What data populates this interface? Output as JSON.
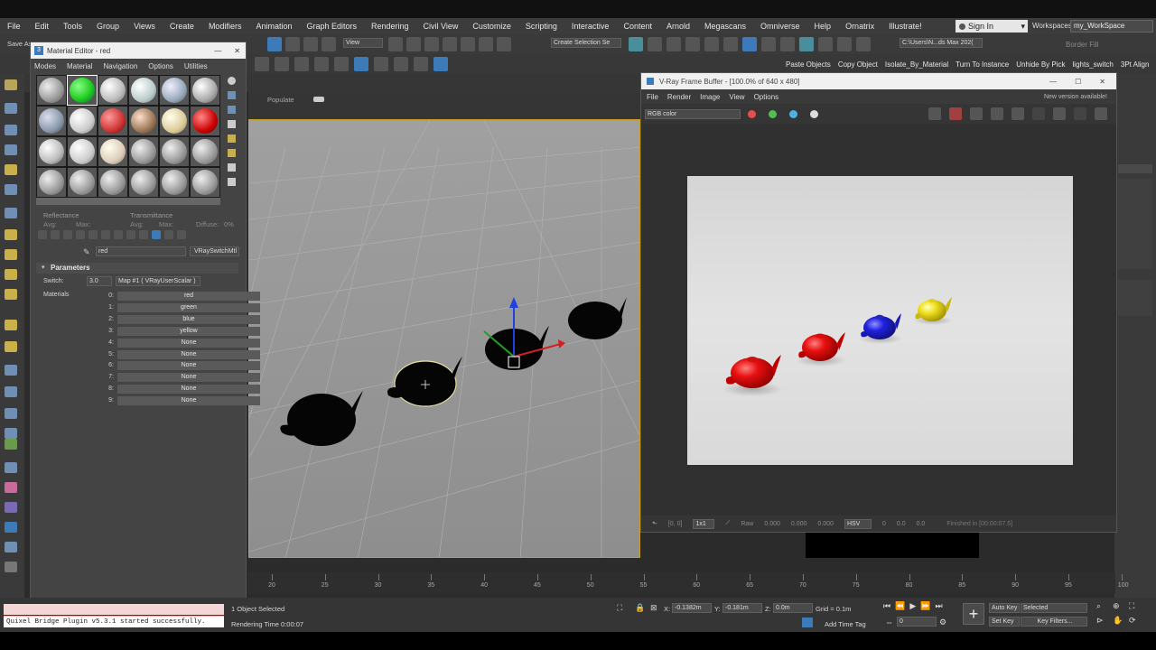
{
  "menu": [
    "File",
    "Edit",
    "Tools",
    "Group",
    "Views",
    "Create",
    "Modifiers",
    "Animation",
    "Graph Editors",
    "Rendering",
    "Civil View",
    "Customize",
    "Scripting",
    "Interactive",
    "Content",
    "Arnold",
    "Megascans",
    "Omniverse",
    "Help",
    "Ornatrix",
    "Illustrate!"
  ],
  "signin_label": "Sign In",
  "workspaces_label": "Workspaces:",
  "workspace_value": "my_WorkSpace",
  "toolbar": {
    "view_dropdown": "View",
    "selection_set": "Create Selection Se",
    "path": "C:\\Users\\N...ds Max 202(",
    "border_fill": "Border Fill",
    "save_as": "Save As"
  },
  "shelf": [
    "Paste Objects",
    "Copy Object",
    "Isolate_By_Material",
    "Turn To Instance",
    "Unhide By Pick",
    "lights_switch",
    "3Pt Align"
  ],
  "viewport_populate": "Populate",
  "material_editor": {
    "title": "Material Editor - red",
    "menu": [
      "Modes",
      "Material",
      "Navigation",
      "Options",
      "Utilities"
    ],
    "reflectance": "Reflectance",
    "avg": "Avg:",
    "max": "Max:",
    "transmittance": "Transmittance",
    "diffuse": "Diffuse:",
    "diffuse_value": "0%",
    "mat_name": "red",
    "mat_type": "VRaySwitchMtl",
    "parameters": "Parameters",
    "switch_label": "Switch:",
    "switch_value": "3.0",
    "map_label": "Map #1  ( VRayUserScalar )",
    "materials_label": "Materials",
    "materials": [
      {
        "idx": "0:",
        "name": "red"
      },
      {
        "idx": "1:",
        "name": "green"
      },
      {
        "idx": "2:",
        "name": "blue"
      },
      {
        "idx": "3:",
        "name": "yellow"
      },
      {
        "idx": "4:",
        "name": "None"
      },
      {
        "idx": "5:",
        "name": "None"
      },
      {
        "idx": "6:",
        "name": "None"
      },
      {
        "idx": "7:",
        "name": "None"
      },
      {
        "idx": "8:",
        "name": "None"
      },
      {
        "idx": "9:",
        "name": "None"
      }
    ]
  },
  "vfb": {
    "title": "V-Ray Frame Buffer - [100.0% of 640 x 480]",
    "menu": [
      "File",
      "Render",
      "Image",
      "View",
      "Options"
    ],
    "new_version": "New version available!",
    "channel": "RGB color",
    "coords": "[0, 0]",
    "zoom": "1x1",
    "raw": "Raw",
    "raw_values": [
      "0.000",
      "0.000",
      "0.000"
    ],
    "color_mode": "HSV",
    "hsv_values": [
      "0",
      "0.0",
      "0.0"
    ],
    "finished": "Finished in [00:00:07.5]"
  },
  "timeline_ticks": [
    "20",
    "25",
    "30",
    "35",
    "40",
    "45",
    "50",
    "55",
    "60",
    "65",
    "70",
    "75",
    "80",
    "85",
    "90",
    "95",
    "100"
  ],
  "status": {
    "selected": "1 Object Selected",
    "render_time": "Rendering Time  0:00:07",
    "x_label": "X:",
    "x_value": "-0.1382m",
    "y_label": "Y:",
    "y_value": "-0.181m",
    "z_label": "Z:",
    "z_value": "0.0m",
    "grid": "Grid = 0.1m",
    "add_time_tag": "Add Time Tag",
    "auto_key": "Auto Key",
    "set_key": "Set Key",
    "selected_dropdown": "Selected",
    "key_filters": "Key Filters...",
    "frame": "0"
  },
  "console": "Quixel Bridge Plugin v5.3.1 started successfully."
}
